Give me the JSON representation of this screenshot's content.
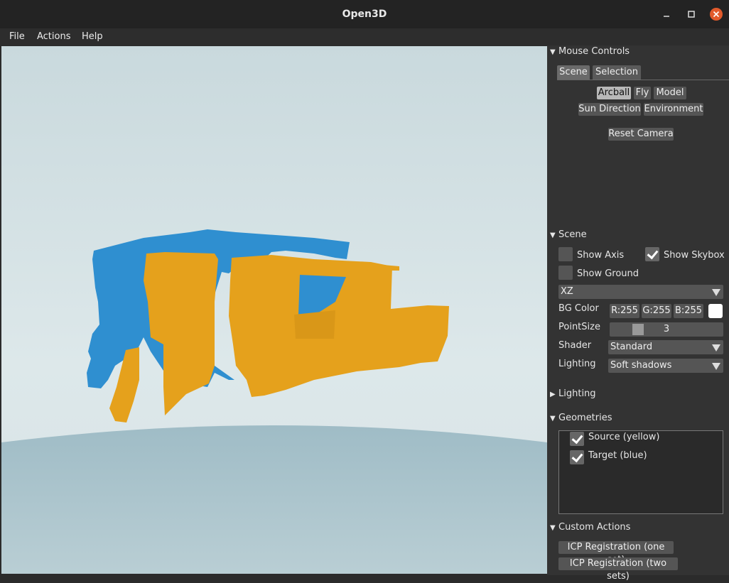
{
  "window": {
    "title": "Open3D"
  },
  "menu": [
    "File",
    "Actions",
    "Help"
  ],
  "mouse_controls": {
    "header": "Mouse Controls",
    "tabs": [
      "Scene",
      "Selection"
    ],
    "modes": [
      "Arcball",
      "Fly",
      "Model",
      "Sun Direction",
      "Environment"
    ],
    "active_mode": "Arcball",
    "reset_label": "Reset Camera"
  },
  "scene": {
    "header": "Scene",
    "show_axis": {
      "label": "Show Axis",
      "checked": false
    },
    "show_skybox": {
      "label": "Show Skybox",
      "checked": true
    },
    "show_ground": {
      "label": "Show Ground",
      "checked": false
    },
    "plane": "XZ",
    "bg_color_label": "BG Color",
    "bg_r": "R:255",
    "bg_g": "G:255",
    "bg_b": "B:255",
    "bg_swatch": "#ffffff",
    "point_size_label": "PointSize",
    "point_size": "3",
    "shader_label": "Shader",
    "shader": "Standard",
    "lighting_label": "Lighting",
    "lighting": "Soft shadows"
  },
  "lighting_section": {
    "header": "Lighting"
  },
  "geometries": {
    "header": "Geometries",
    "items": [
      {
        "label": "Source (yellow)",
        "checked": true
      },
      {
        "label": "Target (blue)",
        "checked": true
      }
    ]
  },
  "custom_actions": {
    "header": "Custom Actions",
    "buttons": [
      "ICP Registration (one set)",
      "ICP Registration (two sets)"
    ]
  },
  "colors": {
    "source": "#e5a11c",
    "target": "#2f8fd0",
    "close": "#e25a2b"
  }
}
